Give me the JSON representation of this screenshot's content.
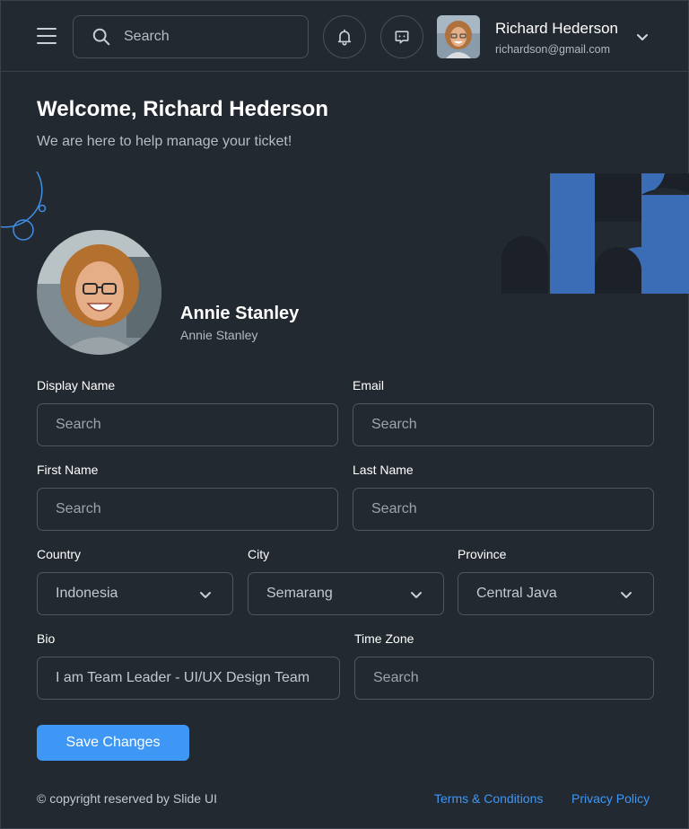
{
  "header": {
    "search_placeholder": "Search",
    "user": {
      "name": "Richard Hederson",
      "email": "richardson@gmail.com"
    }
  },
  "welcome": {
    "title": "Welcome, Richard Hederson",
    "subtitle": "We are here to help manage your ticket!"
  },
  "profile": {
    "name": "Annie Stanley",
    "username": "Annie Stanley"
  },
  "form": {
    "display_name": {
      "label": "Display Name",
      "placeholder": "Search"
    },
    "email": {
      "label": "Email",
      "placeholder": "Search"
    },
    "first_name": {
      "label": "First Name",
      "placeholder": "Search"
    },
    "last_name": {
      "label": "Last Name",
      "placeholder": "Search"
    },
    "country": {
      "label": "Country",
      "value": "Indonesia"
    },
    "city": {
      "label": "City",
      "value": "Semarang"
    },
    "province": {
      "label": "Province",
      "value": "Central Java"
    },
    "bio": {
      "label": "Bio",
      "value": "I am Team Leader - UI/UX Design Team"
    },
    "time_zone": {
      "label": "Time Zone",
      "placeholder": "Search"
    },
    "save_label": "Save Changes"
  },
  "footer": {
    "copyright": "© copyright reserved by Slide UI",
    "terms": "Terms & Conditions",
    "privacy": "Privacy Policy"
  },
  "colors": {
    "accent": "#3f97f5",
    "background": "#232930",
    "border": "#4f5661",
    "deco_blue": "#3a6db5",
    "deco_dark": "#1b2029"
  },
  "icons": [
    "menu-icon",
    "search-icon",
    "bell-icon",
    "chat-icon",
    "chevron-down-icon"
  ]
}
